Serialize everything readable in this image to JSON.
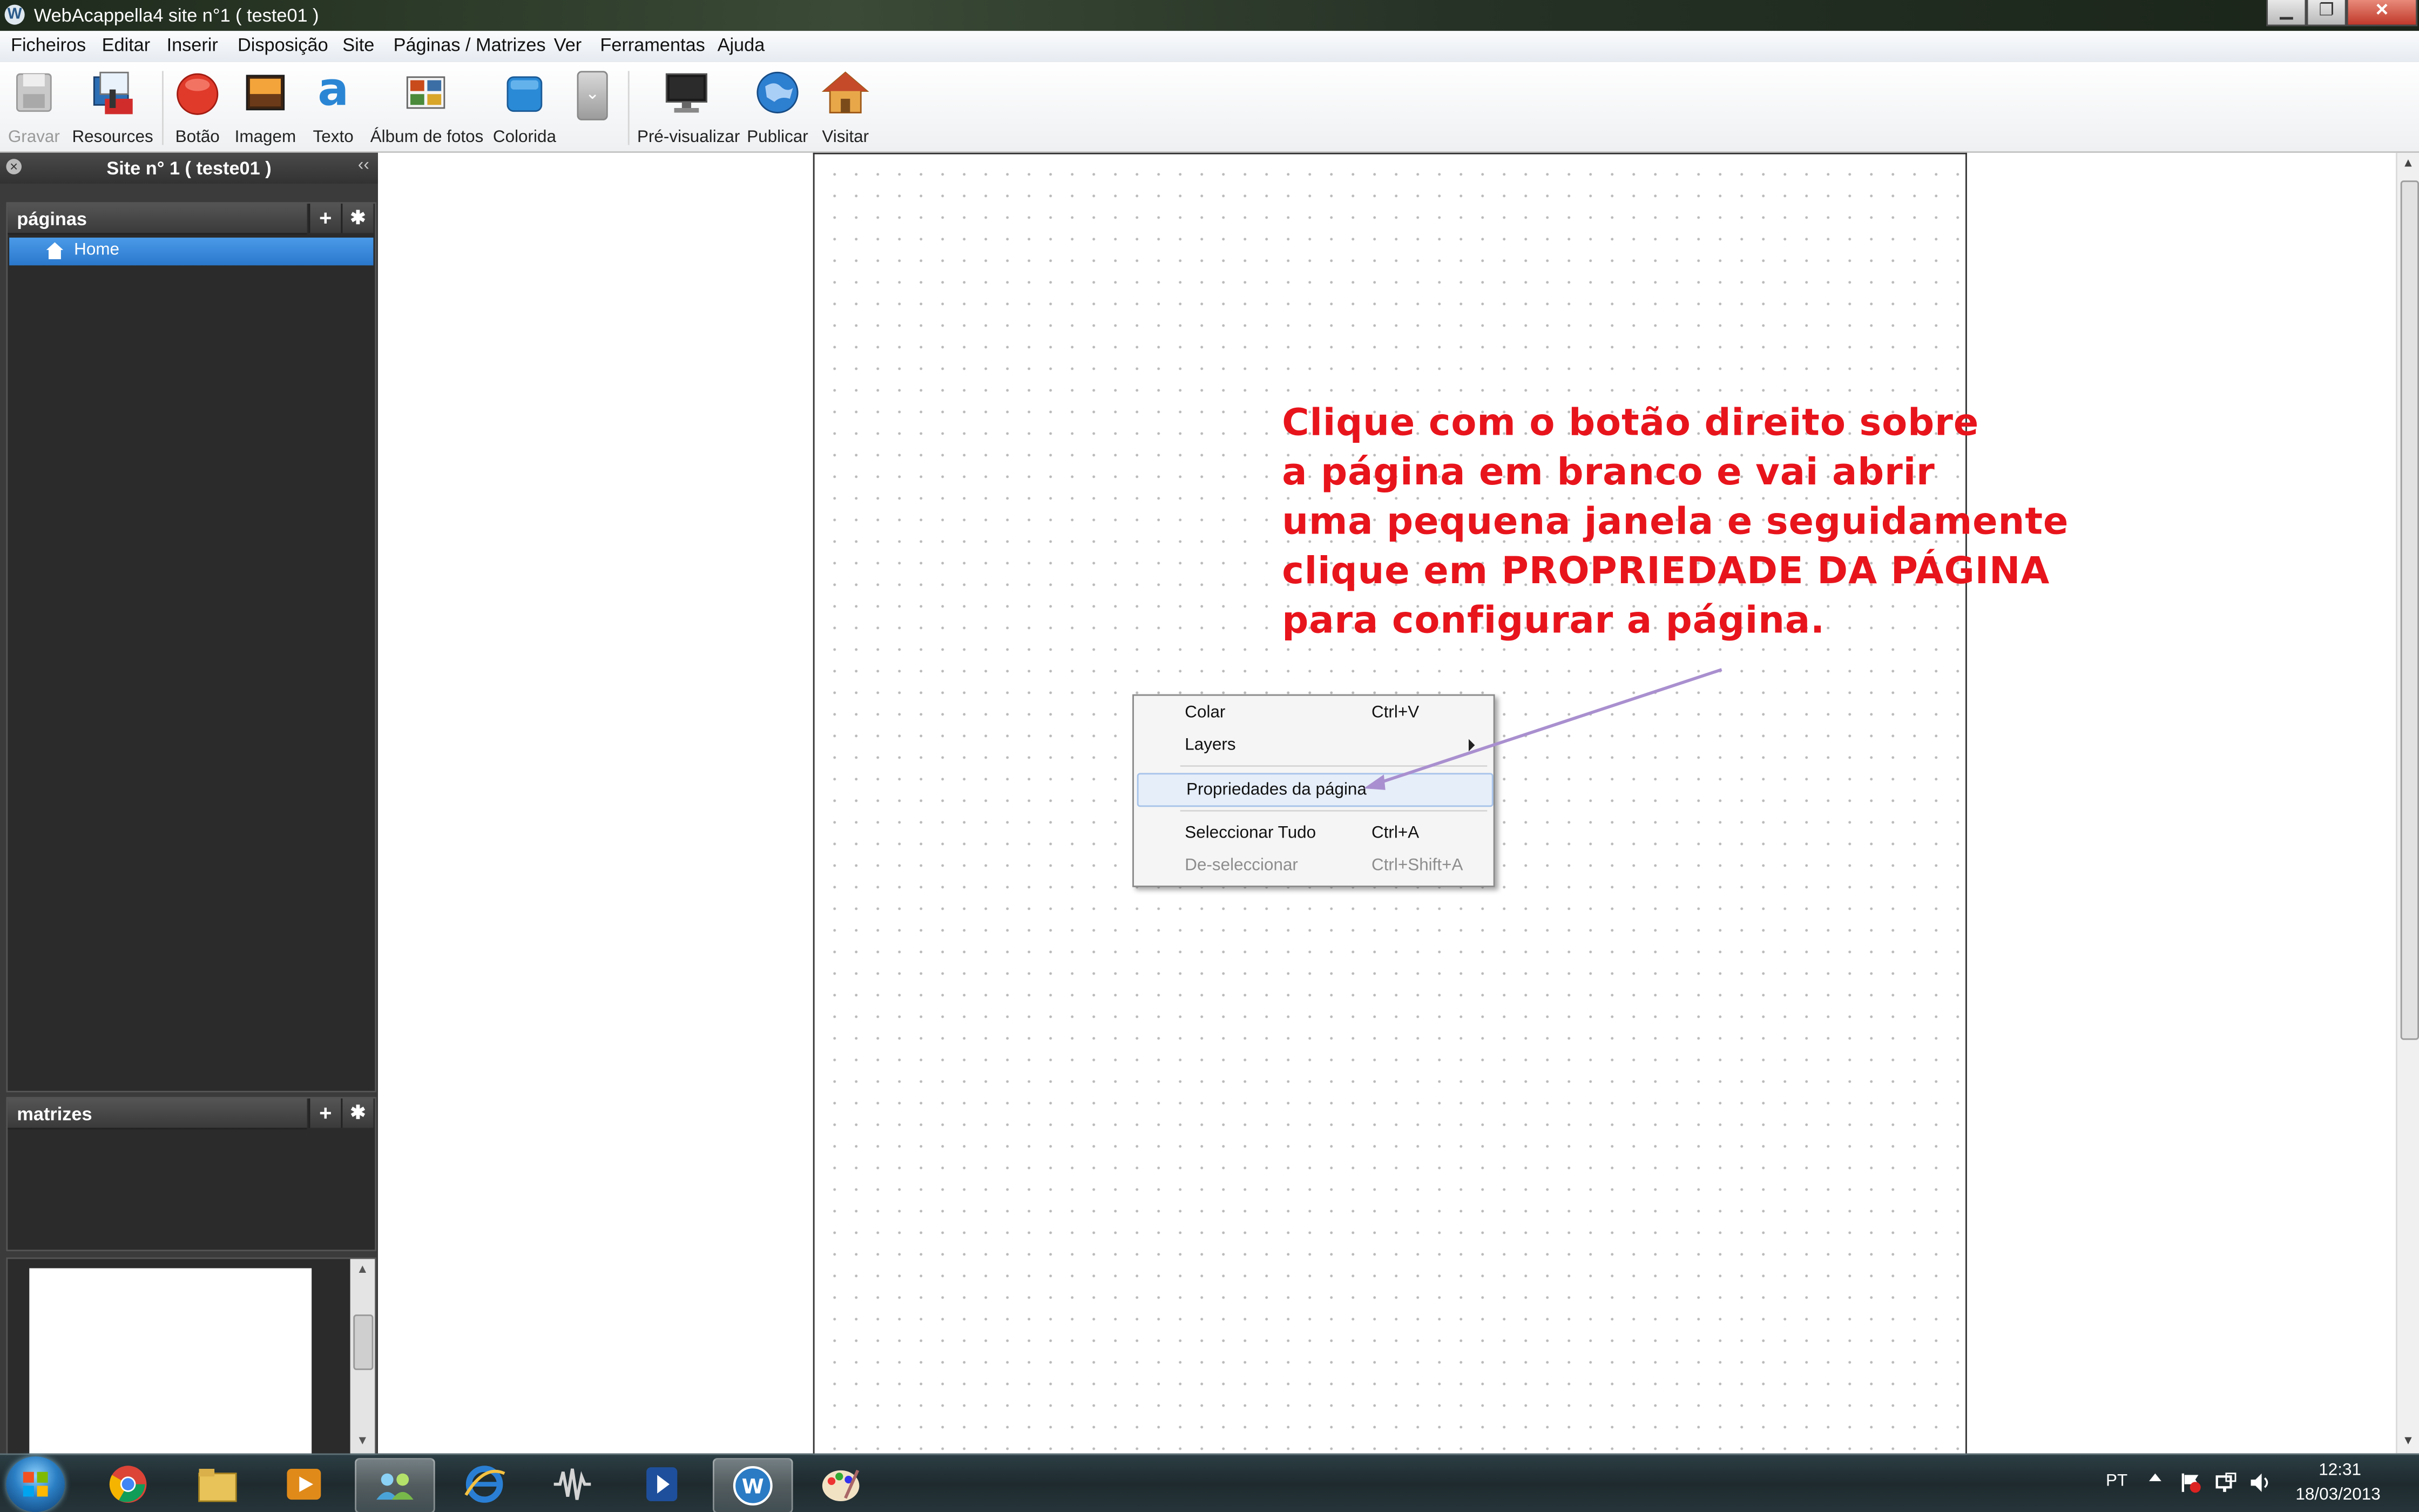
{
  "window": {
    "title": "WebAcappella4 site n°1 ( teste01 )",
    "app_icon_letter": "W",
    "controls": [
      "minimize",
      "maximize",
      "close"
    ]
  },
  "menubar": {
    "items": [
      "Ficheiros",
      "Editar",
      "Inserir",
      "Disposição",
      "Site",
      "Páginas / Matrizes",
      "Ver",
      "Ferramentas",
      "Ajuda"
    ]
  },
  "toolbar": {
    "gravar": "Gravar",
    "resources": "Resources",
    "botao": "Botão",
    "imagem": "Imagem",
    "texto": "Texto",
    "texto_glyph": "a",
    "album": "Álbum de fotos",
    "colorida": "Colorida",
    "pre_visualizar": "Pré-visualizar",
    "publicar": "Publicar",
    "visitar": "Visitar"
  },
  "left_panel": {
    "site_title": "Site n° 1 ( teste01 )",
    "paginas_title": "páginas",
    "pages": [
      {
        "name": "Home",
        "selected": true
      }
    ],
    "matrizes_title": "matrizes",
    "add_glyph": "+",
    "settings_glyph": "✱"
  },
  "annotation": {
    "lines": [
      "Clique com o botão direito sobre",
      "a página em branco e vai abrir",
      "uma pequena janela e seguidamente",
      "clique em PROPRIEDADE DA PÁGINA",
      "para configurar a página."
    ],
    "color": "#e8141c"
  },
  "context_menu": {
    "colar": {
      "label": "Colar",
      "shortcut": "Ctrl+V"
    },
    "layers": {
      "label": "Layers"
    },
    "propriedades": {
      "label": "Propriedades da página",
      "highlighted": true
    },
    "seleccionar": {
      "label": "Seleccionar Tudo",
      "shortcut": "Ctrl+A"
    },
    "deseleccionar": {
      "label": "De-seleccionar",
      "shortcut": "Ctrl+Shift+A",
      "disabled": true
    }
  },
  "taskbar": {
    "apps": [
      "start-orb",
      "chrome",
      "file-explorer",
      "media-player",
      "network-app",
      "internet-explorer",
      "audio-app",
      "windows-media-player",
      "webacappella",
      "paint"
    ],
    "active_apps": [
      "network-app",
      "webacappella"
    ],
    "language": "PT",
    "time": "12:31",
    "date": "18/03/2013"
  }
}
